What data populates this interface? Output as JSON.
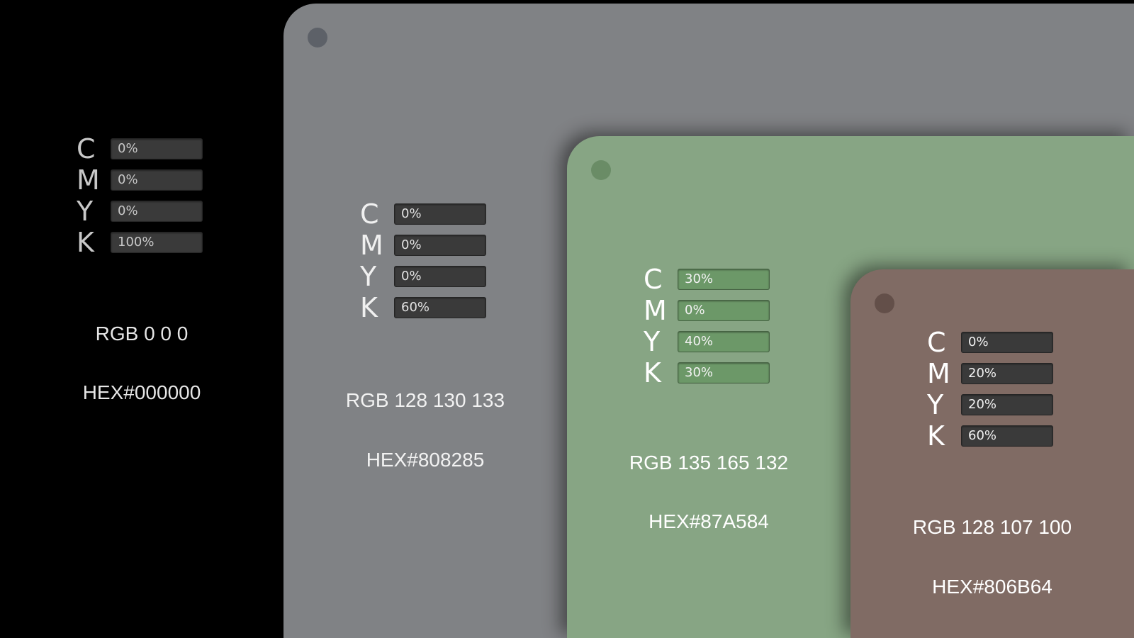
{
  "swatches": [
    {
      "background": "#000000",
      "dot_color": "#000000",
      "letter_color": "#c8c8c8",
      "bar_color": "#3a3a3a",
      "value_color": "#c8c8c8",
      "text_color": "#e6e6e6",
      "cmyk": [
        {
          "letter": "C",
          "value": "0%",
          "fraction": 0.0
        },
        {
          "letter": "M",
          "value": "0%",
          "fraction": 0.0
        },
        {
          "letter": "Y",
          "value": "0%",
          "fraction": 0.0
        },
        {
          "letter": "K",
          "value": "100%",
          "fraction": 1.0
        }
      ],
      "rgb": "RGB 0 0 0",
      "hex": "HEX#000000"
    },
    {
      "background": "#808285",
      "dot_color": "#5d6168",
      "letter_color": "#f0f0f0",
      "bar_color": "#3a3a3a",
      "value_color": "#e2e2e2",
      "text_color": "#f2f2f2",
      "cmyk": [
        {
          "letter": "C",
          "value": "0%",
          "fraction": 0.0
        },
        {
          "letter": "M",
          "value": "0%",
          "fraction": 0.0
        },
        {
          "letter": "Y",
          "value": "0%",
          "fraction": 0.0
        },
        {
          "letter": "K",
          "value": "60%",
          "fraction": 0.6
        }
      ],
      "rgb": "RGB 128 130 133",
      "hex": "HEX#808285"
    },
    {
      "background": "#87A584",
      "dot_color": "#6a8c66",
      "letter_color": "#ffffff",
      "bar_color": "#6c9868",
      "value_color": "#f2f2f2",
      "text_color": "#ffffff",
      "cmyk": [
        {
          "letter": "C",
          "value": "30%",
          "fraction": 0.3
        },
        {
          "letter": "M",
          "value": "0%",
          "fraction": 0.0
        },
        {
          "letter": "Y",
          "value": "40%",
          "fraction": 0.4
        },
        {
          "letter": "K",
          "value": "30%",
          "fraction": 0.3
        }
      ],
      "rgb": "RGB 135 165 132",
      "hex": "HEX#87A584"
    },
    {
      "background": "#806B64",
      "dot_color": "#634f49",
      "letter_color": "#ffffff",
      "bar_color": "#3a3a3a",
      "value_color": "#f2f2f2",
      "text_color": "#ffffff",
      "cmyk": [
        {
          "letter": "C",
          "value": "0%",
          "fraction": 0.0
        },
        {
          "letter": "M",
          "value": "20%",
          "fraction": 0.2
        },
        {
          "letter": "Y",
          "value": "20%",
          "fraction": 0.2
        },
        {
          "letter": "K",
          "value": "60%",
          "fraction": 0.6
        }
      ],
      "rgb": "RGB 128 107 100",
      "hex": "HEX#806B64"
    }
  ]
}
